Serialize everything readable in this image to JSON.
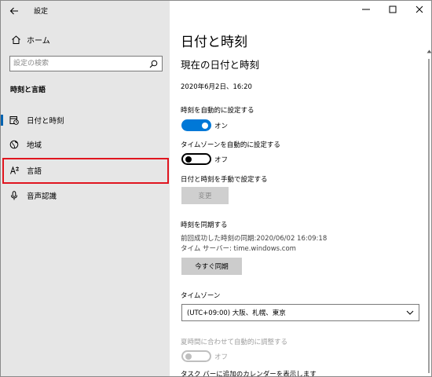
{
  "window": {
    "app_title": "設定",
    "controls": {
      "minimize": "—",
      "maximize": "☐",
      "close": "✕"
    }
  },
  "sidebar": {
    "back_icon": "back-arrow-icon",
    "home_label": "ホーム",
    "search_placeholder": "設定の検索",
    "section_heading": "時刻と言語",
    "items": [
      {
        "label": "日付と時刻",
        "icon": "calendar-clock-icon",
        "selected": true
      },
      {
        "label": "地域",
        "icon": "globe-icon",
        "selected": false
      },
      {
        "label": "言語",
        "icon": "language-icon",
        "selected": false,
        "highlighted": true
      },
      {
        "label": "音声認識",
        "icon": "microphone-icon",
        "selected": false
      }
    ]
  },
  "main": {
    "page_title": "日付と時刻",
    "section_title": "現在の日付と時刻",
    "current_datetime": "2020年6月2日、16:20",
    "auto_time": {
      "label": "時刻を自動的に設定する",
      "state": "オン"
    },
    "auto_timezone": {
      "label": "タイムゾーンを自動的に設定する",
      "state": "オフ"
    },
    "manual": {
      "label": "日付と時刻を手動で設定する",
      "button": "変更"
    },
    "sync": {
      "label": "時刻を同期する",
      "last_sync": "前回成功した時刻の同期:2020/06/02 16:09:18",
      "time_server": "タイム サーバー: time.windows.com",
      "button": "今すぐ同期"
    },
    "timezone": {
      "label": "タイムゾーン",
      "selected": "(UTC+09:00) 大阪、札幌、東京"
    },
    "dst": {
      "label": "夏時間に合わせて自動的に調整する",
      "state": "オフ"
    },
    "taskbar_calendar": {
      "label": "タスク バーに追加のカレンダーを表示します"
    }
  },
  "colors": {
    "accent": "#0078d7",
    "highlight_border": "#e0151f",
    "sidebar_bg": "#e6e6e6"
  }
}
